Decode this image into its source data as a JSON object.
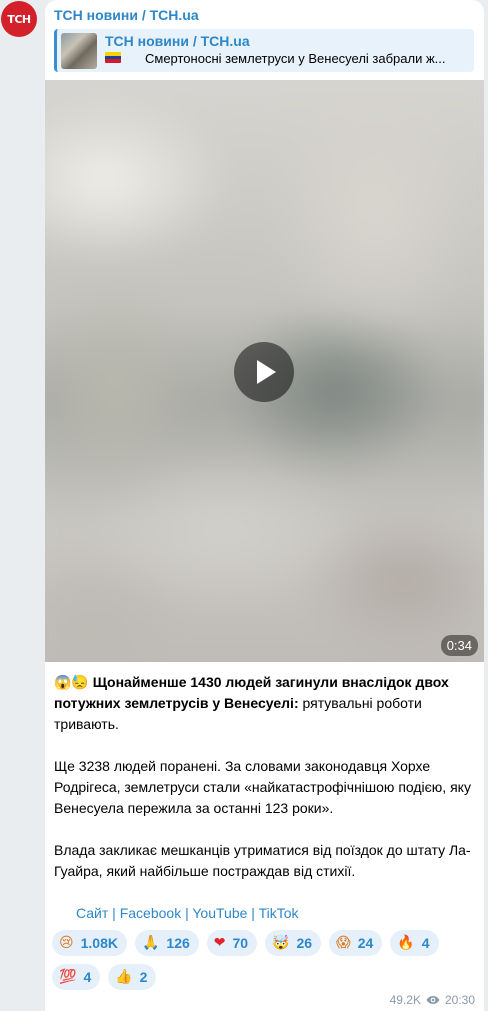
{
  "channel": {
    "avatar_text": "ТСН",
    "name": "ТСН новини / TCH.ua",
    "avatar_color": "#d3202a"
  },
  "reply": {
    "title": "ТСН новини / TCH.ua",
    "flag": "venezuela-flag",
    "text": "Смертоносні землетруси у Венесуелі забрали ж..."
  },
  "video": {
    "duration": "0:34",
    "play_icon": "play-icon"
  },
  "message": {
    "emojis": "😱😓",
    "bold": "Щонайменше 1430 людей загинули внаслідок двох потужних землетрусів у Венесуелі:",
    "lead_rest": " рятувальні роботи тривають.",
    "p2": "Ще 3238 людей поранені. За словами законодавця Хорхе Родрігеса, землетруси стали «найкатастрофічнішою подією, яку Венесуела пережила за останні 123 роки».",
    "p3": "Влада закликає мешканців утриматися від поїздок до штату Ла-Гуайра, який найбільше постраждав від стихії.",
    "links": [
      "Сайт",
      "Facebook",
      "YouTube",
      "TikTok"
    ],
    "link_separator": " | "
  },
  "reactions": [
    {
      "emoji": "😢",
      "count": "1.08K"
    },
    {
      "emoji": "🙏",
      "count": "126"
    },
    {
      "emoji": "❤",
      "count": "70"
    },
    {
      "emoji": "🤯",
      "count": "26"
    },
    {
      "emoji": "😱",
      "count": "24"
    },
    {
      "emoji": "🔥",
      "count": "4"
    },
    {
      "emoji": "💯",
      "count": "4"
    },
    {
      "emoji": "👍",
      "count": "2"
    }
  ],
  "meta": {
    "views": "49.2K",
    "time": "20:30",
    "views_icon": "eye-icon"
  },
  "colors": {
    "accent": "#2e87c8",
    "reaction_bg": "#e5f0fa",
    "meta": "#8a9aa8"
  }
}
